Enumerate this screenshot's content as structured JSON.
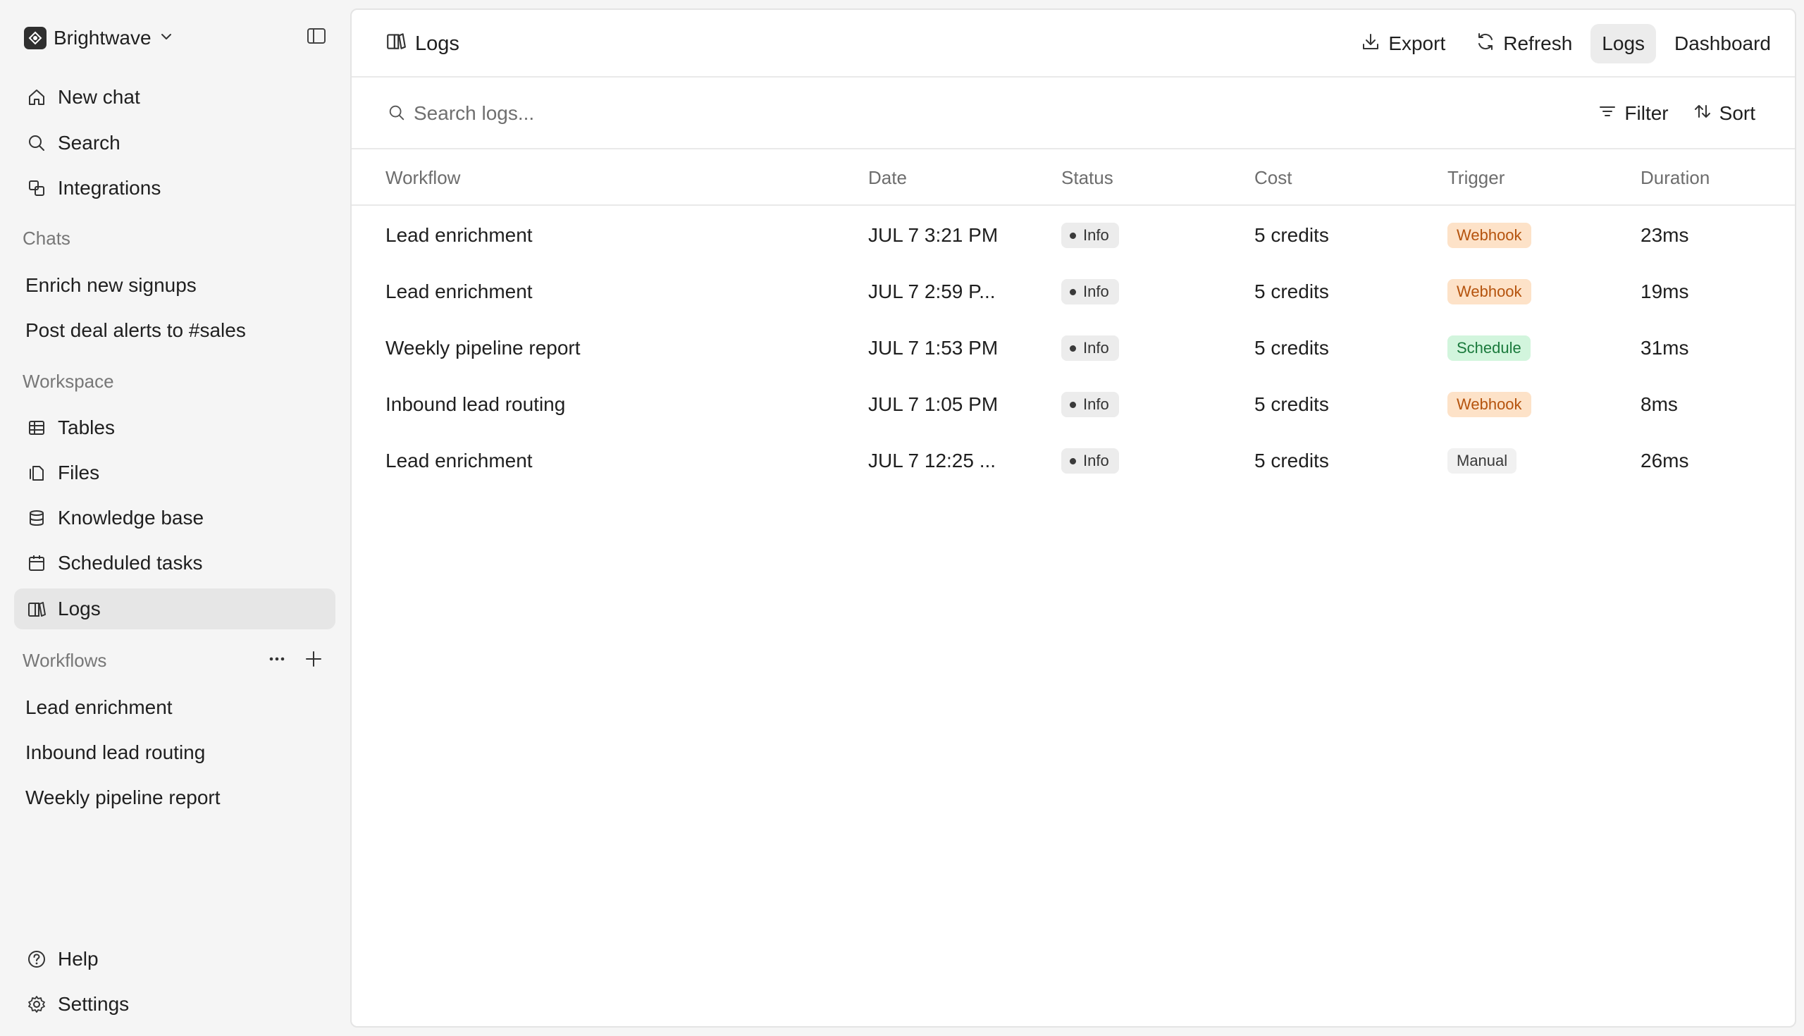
{
  "sidebar": {
    "brand": "Brightwave",
    "nav": [
      {
        "label": "New chat",
        "icon": "home-icon"
      },
      {
        "label": "Search",
        "icon": "search-icon"
      },
      {
        "label": "Integrations",
        "icon": "integrations-icon"
      }
    ],
    "chats_label": "Chats",
    "chats": [
      "Enrich new signups",
      "Post deal alerts to #sales"
    ],
    "workspace_label": "Workspace",
    "workspace": [
      {
        "label": "Tables",
        "icon": "table-icon"
      },
      {
        "label": "Files",
        "icon": "files-icon"
      },
      {
        "label": "Knowledge base",
        "icon": "database-icon"
      },
      {
        "label": "Scheduled tasks",
        "icon": "calendar-icon"
      },
      {
        "label": "Logs",
        "icon": "logs-icon",
        "active": true
      }
    ],
    "workflows_label": "Workflows",
    "workflows": [
      "Lead enrichment",
      "Inbound lead routing",
      "Weekly pipeline report"
    ],
    "footer": [
      {
        "label": "Help",
        "icon": "help-icon"
      },
      {
        "label": "Settings",
        "icon": "gear-icon"
      }
    ]
  },
  "header": {
    "title": "Logs",
    "actions": {
      "export": "Export",
      "refresh": "Refresh",
      "logs": "Logs",
      "dashboard": "Dashboard"
    }
  },
  "search": {
    "placeholder": "Search logs...",
    "filter": "Filter",
    "sort": "Sort"
  },
  "table": {
    "columns": {
      "workflow": "Workflow",
      "date": "Date",
      "status": "Status",
      "cost": "Cost",
      "trigger": "Trigger",
      "duration": "Duration"
    },
    "rows": [
      {
        "workflow": "Lead enrichment",
        "date": "JUL 7 3:21 PM",
        "status": "Info",
        "cost": "5 credits",
        "trigger": "Webhook",
        "duration": "23ms"
      },
      {
        "workflow": "Lead enrichment",
        "date": "JUL 7 2:59 P...",
        "status": "Info",
        "cost": "5 credits",
        "trigger": "Webhook",
        "duration": "19ms"
      },
      {
        "workflow": "Weekly pipeline report",
        "date": "JUL 7 1:53 PM",
        "status": "Info",
        "cost": "5 credits",
        "trigger": "Schedule",
        "duration": "31ms"
      },
      {
        "workflow": "Inbound lead routing",
        "date": "JUL 7 1:05 PM",
        "status": "Info",
        "cost": "5 credits",
        "trigger": "Webhook",
        "duration": "8ms"
      },
      {
        "workflow": "Lead enrichment",
        "date": "JUL 7 12:25 ...",
        "status": "Info",
        "cost": "5 credits",
        "trigger": "Manual",
        "duration": "26ms"
      }
    ]
  },
  "colors": {
    "webhook_bg": "#fde2c8",
    "webhook_text": "#b5530d",
    "schedule_bg": "#d2f5dd",
    "schedule_text": "#1a7a3c",
    "manual_bg": "#f1f1f1",
    "active_nav_bg": "#e6e6e6"
  }
}
